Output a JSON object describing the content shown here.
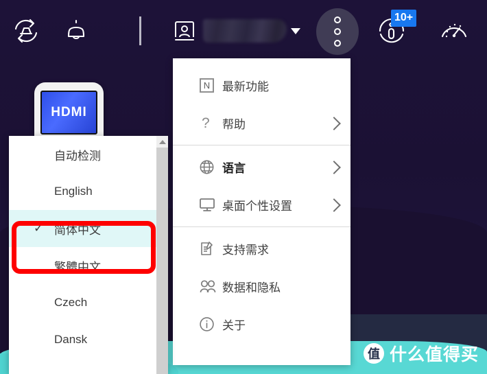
{
  "toolbar": {
    "icons": [
      {
        "name": "sync-icon",
        "title": "同步"
      },
      {
        "name": "bell-icon",
        "title": "通知"
      }
    ],
    "account": {
      "avatar_icon": "user-card-icon",
      "username": "",
      "caret_icon": "chevron-down-icon"
    },
    "more_button": {
      "label": "",
      "icon": "more-vertical-icon"
    },
    "updates": {
      "icon": "updates-icon",
      "badge": "10+"
    },
    "performance": {
      "icon": "gauge-icon"
    }
  },
  "desktop": {
    "tile_label": "HDMI"
  },
  "menu": {
    "items": [
      {
        "id": "whats-new",
        "icon": "n-box-icon",
        "label": "最新功能",
        "submenu": false,
        "bold": false
      },
      {
        "id": "help",
        "icon": "question-icon",
        "label": "帮助",
        "submenu": true,
        "bold": false
      },
      {
        "id": "language",
        "icon": "globe-icon",
        "label": "语言",
        "submenu": true,
        "bold": true
      },
      {
        "id": "desktop",
        "icon": "monitor-icon",
        "label": "桌面个性设置",
        "submenu": true,
        "bold": false
      },
      {
        "id": "support",
        "icon": "document-edit-icon",
        "label": "支持需求",
        "submenu": false,
        "bold": false
      },
      {
        "id": "privacy",
        "icon": "people-icon",
        "label": "数据和隐私",
        "submenu": false,
        "bold": false
      },
      {
        "id": "about",
        "icon": "info-icon",
        "label": "关于",
        "submenu": false,
        "bold": false
      }
    ],
    "dividers_after": [
      "help",
      "desktop"
    ]
  },
  "language_menu": {
    "check_glyph": "✓",
    "selected": "简体中文",
    "items": [
      {
        "label": "自动检测",
        "selected": false
      },
      {
        "label": "English",
        "selected": false
      },
      {
        "label": "简体中文",
        "selected": true
      },
      {
        "label": "繁體中文",
        "selected": false
      },
      {
        "label": "Czech",
        "selected": false
      },
      {
        "label": "Dansk",
        "selected": false
      }
    ],
    "scrollbar": {
      "arrow_icon": "scroll-up-arrow-icon"
    }
  },
  "annotation": {
    "highlight_color": "#fe0000",
    "target": "简体中文"
  },
  "watermark": {
    "logo_char": "值",
    "text": "什么值得买"
  },
  "colors": {
    "background": "#1d1238",
    "accent_cyan": "#58d8d4",
    "badge_blue": "#1878f0",
    "selection": "#e0f7f7",
    "annotation_red": "#fe0000"
  }
}
